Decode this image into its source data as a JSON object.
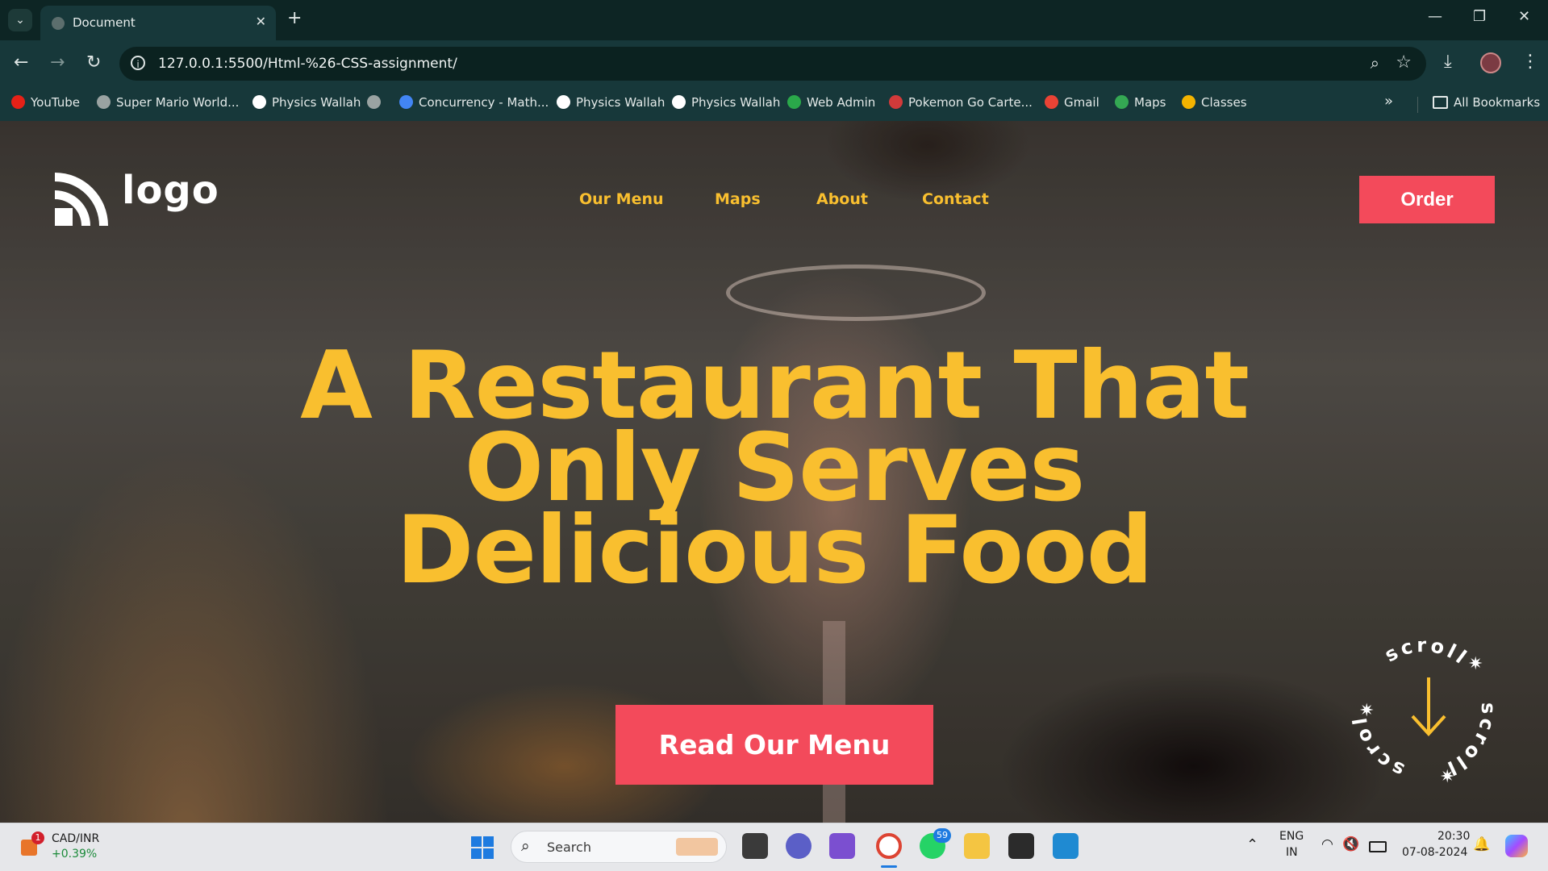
{
  "browser": {
    "tab_title": "Document",
    "url": "127.0.0.1:5500/Html-%26-CSS-assignment/",
    "bookmarks": [
      {
        "label": "YouTube",
        "color": "#e62117"
      },
      {
        "label": "Super Mario World...",
        "color": "#9aa3a2"
      },
      {
        "label": "Physics Wallah",
        "color": "#ffffff"
      },
      {
        "label": "",
        "color": "#9aa3a2"
      },
      {
        "label": "Concurrency - Math...",
        "color": "#4285f4"
      },
      {
        "label": "Physics Wallah",
        "color": "#ffffff"
      },
      {
        "label": "Physics Wallah",
        "color": "#ffffff"
      },
      {
        "label": "Web Admin",
        "color": "#2aa84a"
      },
      {
        "label": "Pokemon Go Carte...",
        "color": "#d23a3a"
      },
      {
        "label": "Gmail",
        "color": "#ea4335"
      },
      {
        "label": "Maps",
        "color": "#34a853"
      },
      {
        "label": "Classes",
        "color": "#f4b400"
      }
    ],
    "more_bookmarks": "»",
    "all_bookmarks": "All Bookmarks"
  },
  "site": {
    "logo_text": "logo",
    "nav": [
      {
        "label": "Our Menu"
      },
      {
        "label": "Maps"
      },
      {
        "label": "About"
      },
      {
        "label": "Contact"
      }
    ],
    "order_label": "Order",
    "headline": [
      "A Restaurant That",
      "Only Serves",
      "Delicious Food"
    ],
    "cta_label": "Read Our Menu",
    "scroll_text": "scroll",
    "colors": {
      "accent": "#f9bf2f",
      "button": "#f34a5b"
    }
  },
  "taskbar": {
    "ticker_symbol": "CAD/INR",
    "ticker_change": "+0.39%",
    "ticker_badge": "1",
    "search_placeholder": "Search",
    "whatsapp_badge": "59",
    "lang_top": "ENG",
    "lang_bottom": "IN",
    "time": "20:30",
    "date": "07-08-2024"
  }
}
